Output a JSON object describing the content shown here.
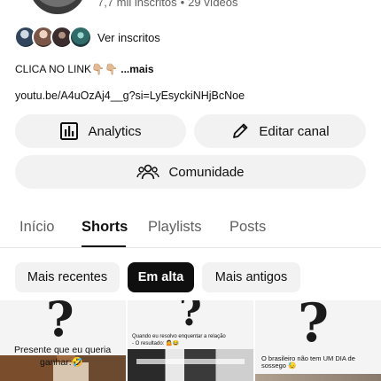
{
  "channel": {
    "stats": {
      "subscribers": "7,7 mil inscritos",
      "separator": "•",
      "videos": "29 vídeos"
    },
    "subscribers_link": "Ver inscritos",
    "description": {
      "text": "CLICA NO LINK👇🏼👇🏼 ",
      "more": "...mais"
    },
    "link": "youtu.be/A4uOzAj4__g?si=LyEsyckiNHjBcNoe"
  },
  "actions": {
    "analytics": "Analytics",
    "edit_channel": "Editar canal",
    "community": "Comunidade"
  },
  "tabs": [
    {
      "label": "Início",
      "active": false
    },
    {
      "label": "Shorts",
      "active": true
    },
    {
      "label": "Playlists",
      "active": false
    },
    {
      "label": "Posts",
      "active": false
    }
  ],
  "sort_chips": [
    {
      "label": "Mais recentes",
      "active": false
    },
    {
      "label": "Em alta",
      "active": true
    },
    {
      "label": "Mais antigos",
      "active": false
    }
  ],
  "shorts": [
    {
      "caption_line1": "Presente que eu queria",
      "caption_line2": "ganhar:🤣"
    },
    {
      "caption_line1": "Quando eu resolvo enquentar a relação",
      "caption_line2": "- O resultado: 🤷😂"
    },
    {
      "caption_line1": "O brasileiro não tem UM DIA de",
      "caption_line2": "sossego 😓"
    }
  ],
  "colors": {
    "text": "#0f0f0f",
    "secondary_text": "#606060",
    "button_bg": "#f2f2f2",
    "active_chip_bg": "#0f0f0f",
    "active_chip_text": "#ffffff"
  }
}
